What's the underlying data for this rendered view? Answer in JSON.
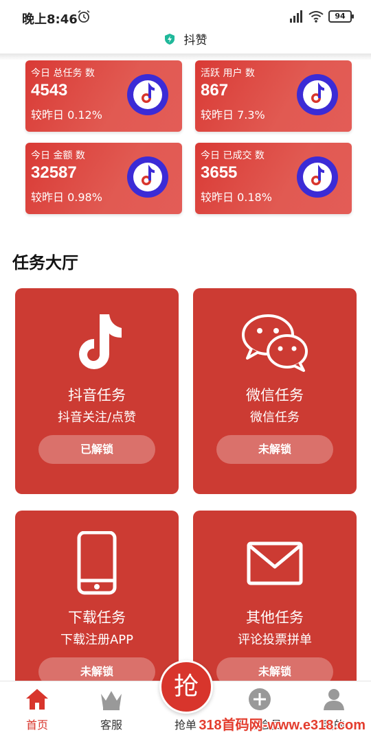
{
  "status_bar": {
    "time": "晚上8:46",
    "battery": "94"
  },
  "app": {
    "title": "抖赞"
  },
  "stats": [
    {
      "label": "今日 总任务 数",
      "value": "4543",
      "change": "较昨日 0.12%"
    },
    {
      "label": "活跃 用户 数",
      "value": "867",
      "change": "较昨日 7.3%"
    },
    {
      "label": "今日 金额 数",
      "value": "32587",
      "change": "较昨日 0.98%"
    },
    {
      "label": "今日 已成交 数",
      "value": "3655",
      "change": "较昨日 0.18%"
    }
  ],
  "section_title": "任务大厅",
  "tasks": [
    {
      "name": "抖音任务",
      "desc": "抖音关注/点赞",
      "button": "已解锁",
      "icon": "tiktok-icon"
    },
    {
      "name": "微信任务",
      "desc": "微信任务",
      "button": "未解锁",
      "icon": "wechat-icon"
    },
    {
      "name": "下载任务",
      "desc": "下载注册APP",
      "button": "未解锁",
      "icon": "phone-icon"
    },
    {
      "name": "其他任务",
      "desc": "评论投票拼单",
      "button": "未解锁",
      "icon": "envelope-icon"
    }
  ],
  "tab_bar": {
    "home": "首页",
    "service": "客服",
    "grab_center": "抢",
    "grab": "抢单",
    "upgrade": "升级会员",
    "mine": "我的"
  },
  "watermark": "318首码网-www.e318.com",
  "colors": {
    "primary": "#cc3b33",
    "accent": "#d8352c",
    "logo": "#3b2bd6"
  }
}
